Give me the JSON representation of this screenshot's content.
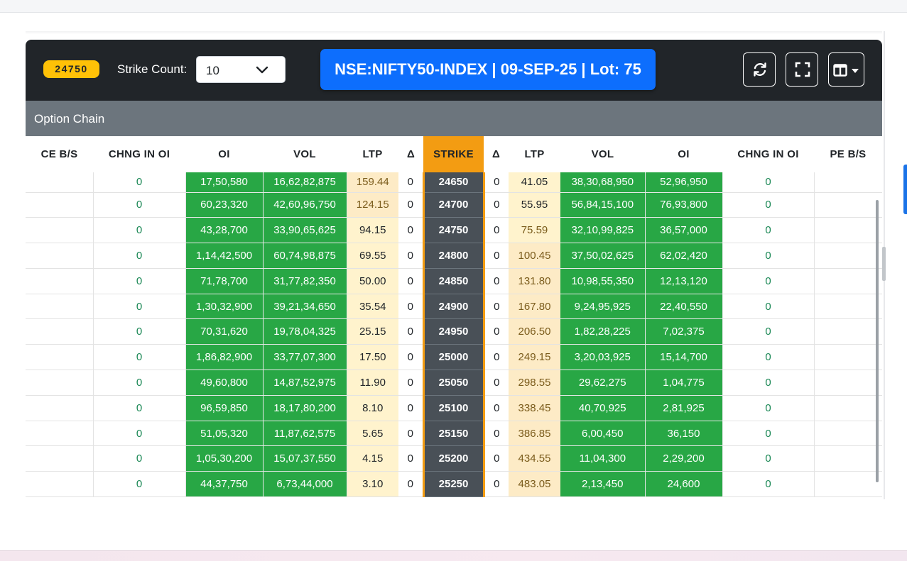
{
  "toolbar": {
    "spot_price": "24750",
    "strike_count_label": "Strike Count:",
    "strike_count_value": "10",
    "symbol_info": "NSE:NIFTY50-INDEX | 09-SEP-25 | Lot: 75",
    "refresh_icon": "refresh-icon",
    "fullscreen_icon": "fullscreen-icon",
    "columns_icon": "columns-layout-icon"
  },
  "card": {
    "title": "Option Chain"
  },
  "columns": [
    "CE B/S",
    "CHNG IN OI",
    "OI",
    "VOL",
    "LTP",
    "Δ",
    "STRIKE",
    "Δ",
    "LTP",
    "VOL",
    "OI",
    "CHNG IN OI",
    "PE B/S"
  ],
  "colors": {
    "green": "#28a745",
    "strike": "#495057",
    "accent": "#f39c12",
    "symbol": "#0d6efd"
  },
  "rows": [
    {
      "ce_bs": "",
      "ce_chng": "0",
      "ce_oi": "17,50,580",
      "ce_vol": "16,62,82,875",
      "ce_ltp": "159.44",
      "ce_delta": "0",
      "strike": "24650",
      "pe_delta": "0",
      "pe_ltp": "41.05",
      "pe_vol": "38,30,68,950",
      "pe_oi": "52,96,950",
      "pe_chng": "0",
      "pe_bs": ""
    },
    {
      "ce_bs": "",
      "ce_chng": "0",
      "ce_oi": "60,23,320",
      "ce_vol": "42,60,96,750",
      "ce_ltp": "124.15",
      "ce_delta": "0",
      "strike": "24700",
      "pe_delta": "0",
      "pe_ltp": "55.95",
      "pe_vol": "56,84,15,100",
      "pe_oi": "76,93,800",
      "pe_chng": "0",
      "pe_bs": ""
    },
    {
      "ce_bs": "",
      "ce_chng": "0",
      "ce_oi": "43,28,700",
      "ce_vol": "33,90,65,625",
      "ce_ltp": "94.15",
      "ce_delta": "0",
      "strike": "24750",
      "pe_delta": "0",
      "pe_ltp": "75.59",
      "pe_vol": "32,10,99,825",
      "pe_oi": "36,57,000",
      "pe_chng": "0",
      "pe_bs": ""
    },
    {
      "ce_bs": "",
      "ce_chng": "0",
      "ce_oi": "1,14,42,500",
      "ce_vol": "60,74,98,875",
      "ce_ltp": "69.55",
      "ce_delta": "0",
      "strike": "24800",
      "pe_delta": "0",
      "pe_ltp": "100.45",
      "pe_vol": "37,50,02,625",
      "pe_oi": "62,02,420",
      "pe_chng": "0",
      "pe_bs": ""
    },
    {
      "ce_bs": "",
      "ce_chng": "0",
      "ce_oi": "71,78,700",
      "ce_vol": "31,77,82,350",
      "ce_ltp": "50.00",
      "ce_delta": "0",
      "strike": "24850",
      "pe_delta": "0",
      "pe_ltp": "131.80",
      "pe_vol": "10,98,55,350",
      "pe_oi": "12,13,120",
      "pe_chng": "0",
      "pe_bs": ""
    },
    {
      "ce_bs": "",
      "ce_chng": "0",
      "ce_oi": "1,30,32,900",
      "ce_vol": "39,21,34,650",
      "ce_ltp": "35.54",
      "ce_delta": "0",
      "strike": "24900",
      "pe_delta": "0",
      "pe_ltp": "167.80",
      "pe_vol": "9,24,95,925",
      "pe_oi": "22,40,550",
      "pe_chng": "0",
      "pe_bs": ""
    },
    {
      "ce_bs": "",
      "ce_chng": "0",
      "ce_oi": "70,31,620",
      "ce_vol": "19,78,04,325",
      "ce_ltp": "25.15",
      "ce_delta": "0",
      "strike": "24950",
      "pe_delta": "0",
      "pe_ltp": "206.50",
      "pe_vol": "1,82,28,225",
      "pe_oi": "7,02,375",
      "pe_chng": "0",
      "pe_bs": ""
    },
    {
      "ce_bs": "",
      "ce_chng": "0",
      "ce_oi": "1,86,82,900",
      "ce_vol": "33,77,07,300",
      "ce_ltp": "17.50",
      "ce_delta": "0",
      "strike": "25000",
      "pe_delta": "0",
      "pe_ltp": "249.15",
      "pe_vol": "3,20,03,925",
      "pe_oi": "15,14,700",
      "pe_chng": "0",
      "pe_bs": ""
    },
    {
      "ce_bs": "",
      "ce_chng": "0",
      "ce_oi": "49,60,800",
      "ce_vol": "14,87,52,975",
      "ce_ltp": "11.90",
      "ce_delta": "0",
      "strike": "25050",
      "pe_delta": "0",
      "pe_ltp": "298.55",
      "pe_vol": "29,62,275",
      "pe_oi": "1,04,775",
      "pe_chng": "0",
      "pe_bs": ""
    },
    {
      "ce_bs": "",
      "ce_chng": "0",
      "ce_oi": "96,59,850",
      "ce_vol": "18,17,80,200",
      "ce_ltp": "8.10",
      "ce_delta": "0",
      "strike": "25100",
      "pe_delta": "0",
      "pe_ltp": "338.45",
      "pe_vol": "40,70,925",
      "pe_oi": "2,81,925",
      "pe_chng": "0",
      "pe_bs": ""
    },
    {
      "ce_bs": "",
      "ce_chng": "0",
      "ce_oi": "51,05,320",
      "ce_vol": "11,87,62,575",
      "ce_ltp": "5.65",
      "ce_delta": "0",
      "strike": "25150",
      "pe_delta": "0",
      "pe_ltp": "386.85",
      "pe_vol": "6,00,450",
      "pe_oi": "36,150",
      "pe_chng": "0",
      "pe_bs": ""
    },
    {
      "ce_bs": "",
      "ce_chng": "0",
      "ce_oi": "1,05,30,200",
      "ce_vol": "15,07,37,550",
      "ce_ltp": "4.15",
      "ce_delta": "0",
      "strike": "25200",
      "pe_delta": "0",
      "pe_ltp": "434.55",
      "pe_vol": "11,04,300",
      "pe_oi": "2,29,200",
      "pe_chng": "0",
      "pe_bs": ""
    },
    {
      "ce_bs": "",
      "ce_chng": "0",
      "ce_oi": "44,37,750",
      "ce_vol": "6,73,44,000",
      "ce_ltp": "3.10",
      "ce_delta": "0",
      "strike": "25250",
      "pe_delta": "0",
      "pe_ltp": "483.05",
      "pe_vol": "2,13,450",
      "pe_oi": "24,600",
      "pe_chng": "0",
      "pe_bs": ""
    }
  ]
}
